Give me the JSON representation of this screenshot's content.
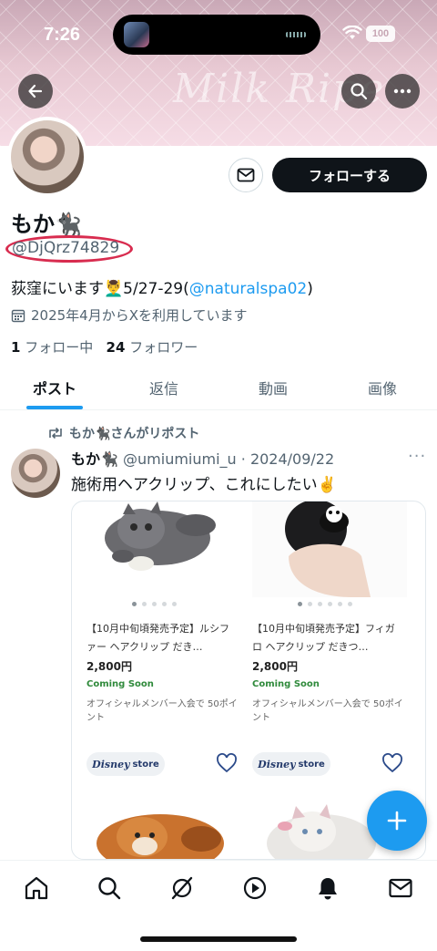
{
  "status_bar": {
    "time": "7:26",
    "battery": "100"
  },
  "banner": {
    "text": "Milk Ripe"
  },
  "profile": {
    "display_name": "もか🐈‍⬛",
    "handle": "@DjQrz74829",
    "bio_text": "荻窪にいます💆‍♂️5/27-29(",
    "bio_link": "@naturalspa02",
    "bio_end": ")",
    "joined": "2025年4月からXを利用しています",
    "following_count": "1",
    "following_label": "フォロー中",
    "followers_count": "24",
    "followers_label": "フォロワー",
    "follow_button": "フォローする"
  },
  "tabs": [
    {
      "label": "ポスト",
      "active": true
    },
    {
      "label": "返信"
    },
    {
      "label": "動画"
    },
    {
      "label": "画像"
    }
  ],
  "post": {
    "repost_label": "もか🐈‍⬛さんがリポスト",
    "author_name": "もか🐈‍⬛",
    "author_meta": "@umiumiumi_u · 2024/09/22",
    "more": "···",
    "text": "施術用ヘアクリップ、これにしたい✌️"
  },
  "products": [
    {
      "title": "【10月中旬頃発売予定】ルシファー ヘアクリップ だき…",
      "price": "2,800円",
      "status": "Coming Soon",
      "note": "オフィシャルメンバー入会で 50ポイント",
      "store_brand": "Disney",
      "store_label": "store"
    },
    {
      "title": "【10月中旬頃発売予定】フィガロ ヘアクリップ だきつ…",
      "price": "2,800円",
      "status": "Coming Soon",
      "note": "オフィシャルメンバー入会で 50ポイント",
      "store_brand": "Disney",
      "store_label": "store"
    }
  ],
  "colors": {
    "accent": "#1d9bf0",
    "text": "#0f1419",
    "muted": "#536471",
    "highlight_circle": "#d82c4f"
  }
}
